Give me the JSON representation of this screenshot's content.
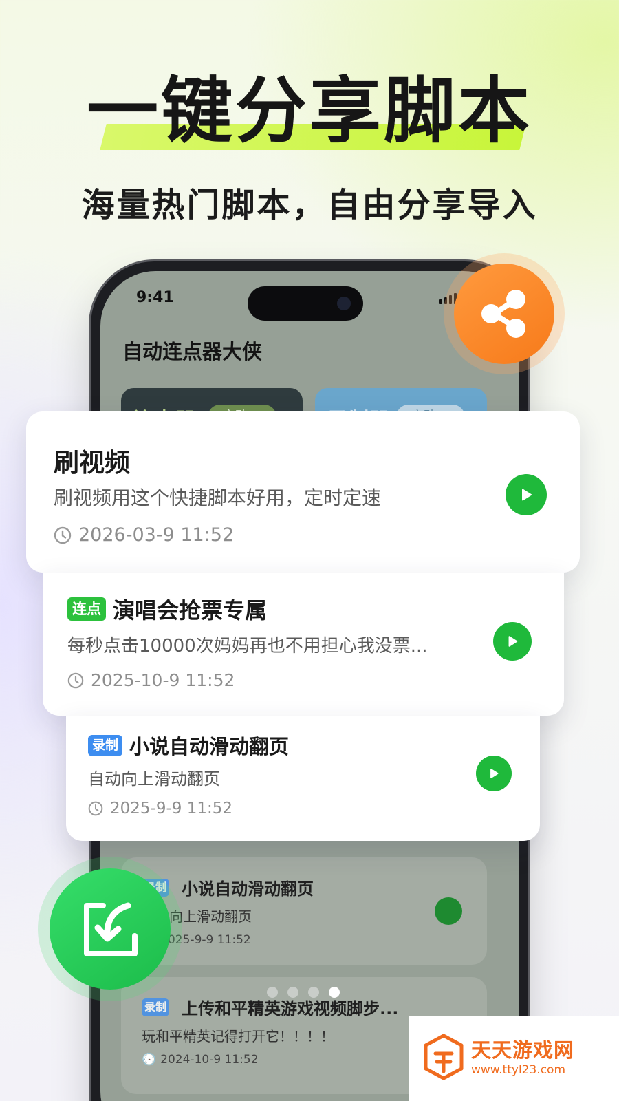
{
  "headline": {
    "title": "一键分享脚本",
    "subtitle": "海量热门脚本，自由分享导入"
  },
  "phone": {
    "status_time": "9:41",
    "app_title": "自动连点器大侠",
    "mode_cards": [
      {
        "label": "连点器",
        "pill": "启动 >"
      },
      {
        "label": "录制器",
        "pill": "启动 >"
      }
    ],
    "inner_cards": [
      {
        "tag": "录制",
        "title": "小说自动滑动翻页",
        "desc": "自动向上滑动翻页",
        "time": "2025-9-9 11:52"
      },
      {
        "tag": "录制",
        "title": "上传和平精英游戏视频脚步...",
        "desc": "玩和平精英记得打开它！！！！",
        "time": "2024-10-9 11:52"
      }
    ],
    "carousel": {
      "count": 4,
      "active_index": 3
    }
  },
  "cards": [
    {
      "tag": "",
      "title": "刷视频",
      "desc": "刷视频用这个快捷脚本好用，定时定速",
      "time": "2026-03-9 11:52"
    },
    {
      "tag": "连点",
      "title": "演唱会抢票专属",
      "desc": "每秒点击10000次妈妈再也不用担心我没票...",
      "time": "2025-10-9 11:52"
    },
    {
      "tag": "录制",
      "title": "小说自动滑动翻页",
      "desc": "自动向上滑动翻页",
      "time": "2025-9-9 11:52"
    }
  ],
  "icons": {
    "share": "share-icon",
    "import": "import-icon",
    "play": "play-icon",
    "clock": "clock-icon"
  },
  "colors": {
    "accent_green": "#1fb93b",
    "share_orange": "#f77a1a",
    "highlight": "#c8f53a",
    "tag_green": "#2cc13d",
    "tag_blue": "#3d8df0"
  },
  "watermark": {
    "name": "天天游戏网",
    "url": "www.ttyl23.com"
  }
}
